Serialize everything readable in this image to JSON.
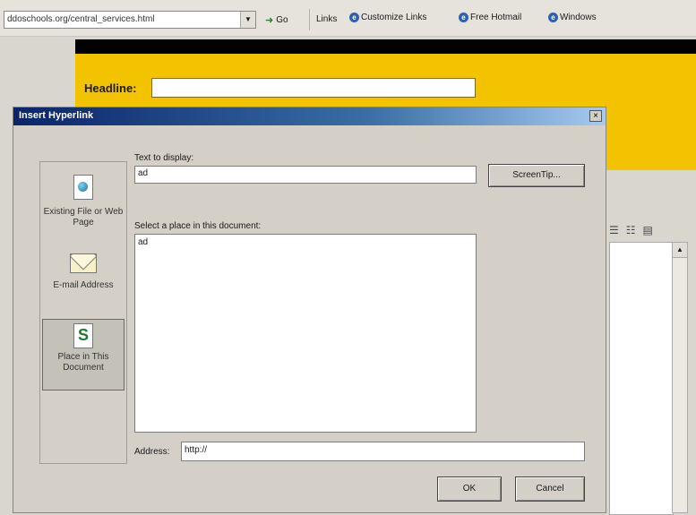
{
  "browser": {
    "address": "ddoschools.org/central_services.html",
    "go_label": "Go",
    "links_label": "Links",
    "links": [
      {
        "label": "Customize Links"
      },
      {
        "label": "Free Hotmail"
      },
      {
        "label": "Windows"
      }
    ]
  },
  "page": {
    "headline_label": "Headline:",
    "headline_value": ""
  },
  "dialog": {
    "title": "Insert Hyperlink",
    "close_glyph": "×",
    "link_to": [
      {
        "label": "Existing File or Web Page",
        "icon": "web-page-icon",
        "selected": false
      },
      {
        "label": "E-mail Address",
        "icon": "email-icon",
        "selected": false
      },
      {
        "label": "Place in This Document",
        "icon": "place-in-document-icon",
        "selected": true
      }
    ],
    "text_to_display_label": "Text to display:",
    "text_to_display_value": "ad",
    "screentip_label": "ScreenTip...",
    "place_label": "Select a place in this document:",
    "place_items": [
      "ad"
    ],
    "address_label": "Address:",
    "address_value": "http://",
    "ok_label": "OK",
    "cancel_label": "Cancel"
  },
  "colors": {
    "page_accent": "#f4c300",
    "titlebar_start": "#0a246a",
    "titlebar_end": "#a6caf0",
    "dialog_face": "#d4d0c8"
  }
}
